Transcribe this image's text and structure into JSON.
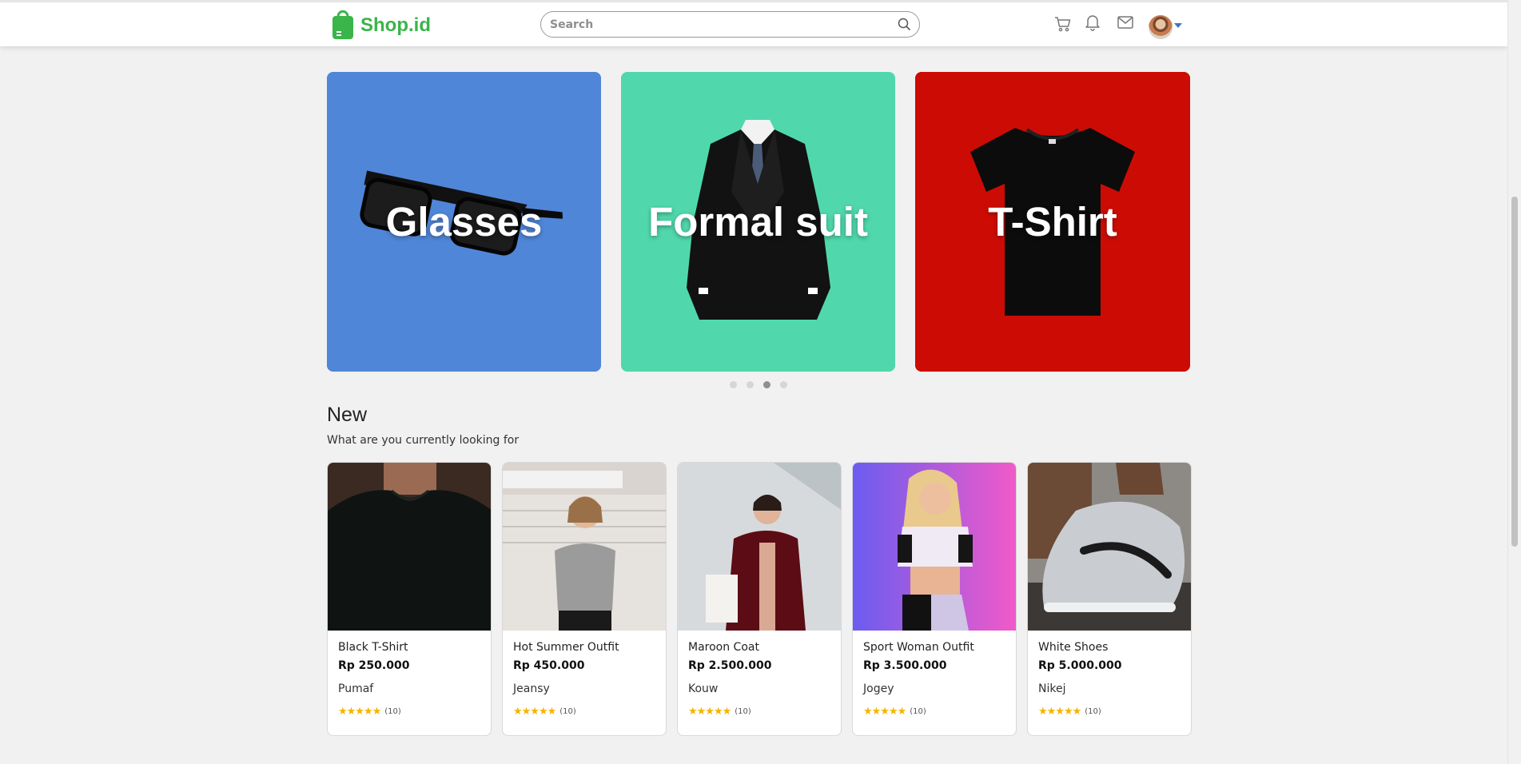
{
  "brand": {
    "name": "Shop.id",
    "color": "#39b54a"
  },
  "search": {
    "placeholder": "Search"
  },
  "header_icons": [
    "cart-icon",
    "bell-icon",
    "mail-icon"
  ],
  "banners": [
    {
      "label": "Glasses",
      "bg": "#5086d8"
    },
    {
      "label": "Formal suit",
      "bg": "#50d8ac"
    },
    {
      "label": "T-Shirt",
      "bg": "#cc0c04"
    }
  ],
  "carousel": {
    "dots": 4,
    "active": 3
  },
  "section": {
    "title": "New",
    "subtitle": "What are you currently looking for"
  },
  "products": [
    {
      "name": "Black T-Shirt",
      "price": "Rp 250.000",
      "brand": "Pumaf",
      "stars": "★★★★★",
      "reviews": "(10)"
    },
    {
      "name": "Hot Summer Outfit",
      "price": "Rp 450.000",
      "brand": "Jeansy",
      "stars": "★★★★★",
      "reviews": "(10)"
    },
    {
      "name": "Maroon Coat",
      "price": "Rp 2.500.000",
      "brand": "Kouw",
      "stars": "★★★★★",
      "reviews": "(10)"
    },
    {
      "name": "Sport Woman Outfit",
      "price": "Rp 3.500.000",
      "brand": "Jogey",
      "stars": "★★★★★",
      "reviews": "(10)"
    },
    {
      "name": "White Shoes",
      "price": "Rp 5.000.000",
      "brand": "Nikej",
      "stars": "★★★★★",
      "reviews": "(10)"
    }
  ]
}
